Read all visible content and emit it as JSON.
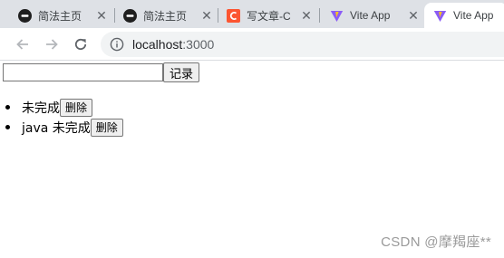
{
  "browser": {
    "tabs": [
      {
        "title": "简法主页",
        "icon": "jianfa-icon"
      },
      {
        "title": "简法主页",
        "icon": "jianfa-icon"
      },
      {
        "title": "写文章-C",
        "icon": "csdn-icon"
      },
      {
        "title": "Vite App",
        "icon": "vite-icon"
      },
      {
        "title": "Vite App",
        "icon": "vite-icon"
      }
    ],
    "close_glyph": "✕",
    "address": {
      "host": "localhost",
      "port": ":3000"
    }
  },
  "app": {
    "input": {
      "value": "",
      "placeholder": ""
    },
    "record_label": "记录",
    "todos": [
      {
        "text": "未完成",
        "delete_label": "删除"
      },
      {
        "text": "java 未完成",
        "delete_label": "删除"
      }
    ]
  },
  "watermark": "CSDN @摩羯座**",
  "colors": {
    "tabstrip": "#dee1e6",
    "omnibox": "#f1f3f4",
    "csdn_red": "#fc5531",
    "vite_purple": "#8b5cf6",
    "vite_yellow": "#ffc517"
  }
}
